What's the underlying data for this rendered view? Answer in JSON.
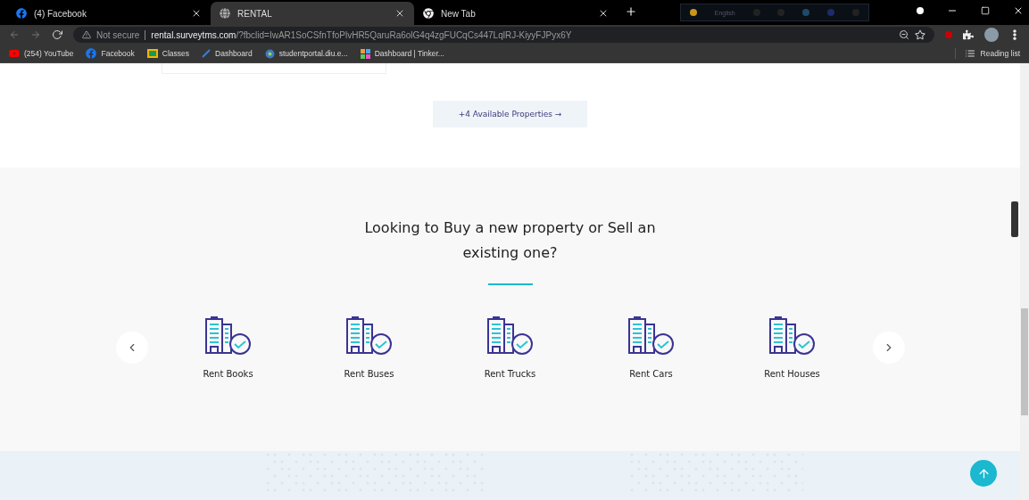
{
  "browser": {
    "tabs": [
      {
        "title": "(4) Facebook",
        "selected": false
      },
      {
        "title": "RENTAL",
        "selected": true
      },
      {
        "title": "New Tab",
        "selected": false
      }
    ],
    "language_bar": {
      "label": "English"
    },
    "address": {
      "security": "Not secure",
      "host": "rental.surveytms.com",
      "path": "/?fbclid=IwAR1SoCSfnTfoPlvHR5QaruRa6olG4q4zgFUCqCs447LqlRJ-KiyyFJPyx6Y"
    },
    "bookmarks": [
      "(254) YouTube",
      "Facebook",
      "Classes",
      "Dashboard",
      "studentportal.diu.e...",
      "Dashboard | Tinker..."
    ],
    "reading_list": "Reading list"
  },
  "page": {
    "more_button": "+4 Available Properties →",
    "heading": "Looking to Buy a new property or Sell an existing one?",
    "categories": [
      {
        "label": "Rent Books"
      },
      {
        "label": "Rent Buses"
      },
      {
        "label": "Rent Trucks"
      },
      {
        "label": "Rent Cars"
      },
      {
        "label": "Rent Houses"
      }
    ]
  }
}
